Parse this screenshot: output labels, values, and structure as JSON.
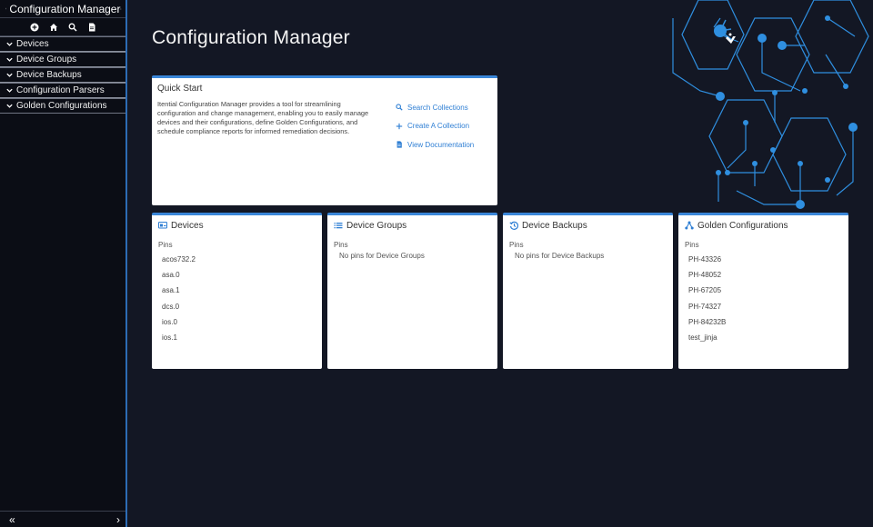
{
  "sidebar": {
    "title": "Configuration Manager",
    "tools": [
      "add-icon",
      "home-icon",
      "search-icon",
      "document-icon"
    ],
    "items": [
      {
        "label": "Devices"
      },
      {
        "label": "Device Groups"
      },
      {
        "label": "Device Backups"
      },
      {
        "label": "Configuration Parsers"
      },
      {
        "label": "Golden Configurations"
      }
    ],
    "footer": {
      "collapse": "«",
      "expand": "›"
    }
  },
  "main": {
    "title": "Configuration Manager",
    "quick_start": {
      "title": "Quick Start",
      "description": "Itential Configuration Manager provides a tool for streamlining configuration and change management, enabling you to easily manage devices and their configurations, define Golden Configurations, and schedule compliance reports for informed remediation decisions.",
      "links": [
        {
          "label": "Search Collections",
          "icon": "search-icon"
        },
        {
          "label": "Create A Collection",
          "icon": "plus-icon"
        },
        {
          "label": "View Documentation",
          "icon": "document-icon"
        }
      ]
    },
    "cards": [
      {
        "title": "Devices",
        "icon": "devices-icon",
        "pins_label": "Pins",
        "pins": [
          "acos732.2",
          "asa.0",
          "asa.1",
          "dcs.0",
          "ios.0",
          "ios.1"
        ],
        "empty": ""
      },
      {
        "title": "Device Groups",
        "icon": "list-icon",
        "pins_label": "Pins",
        "pins": [],
        "empty": "No pins for Device Groups"
      },
      {
        "title": "Device Backups",
        "icon": "history-icon",
        "pins_label": "Pins",
        "pins": [],
        "empty": "No pins for Device Backups"
      },
      {
        "title": "Golden Configurations",
        "icon": "hierarchy-icon",
        "pins_label": "Pins",
        "pins": [
          "PH-43326",
          "PH-48052",
          "PH-67205",
          "PH-74327",
          "PH-84232B",
          "test_jinja"
        ],
        "empty": ""
      }
    ]
  },
  "colors": {
    "accent": "#3a86d8",
    "background": "#131724",
    "sidebar": "#0b0d15",
    "decor": "#2f8fe0"
  }
}
